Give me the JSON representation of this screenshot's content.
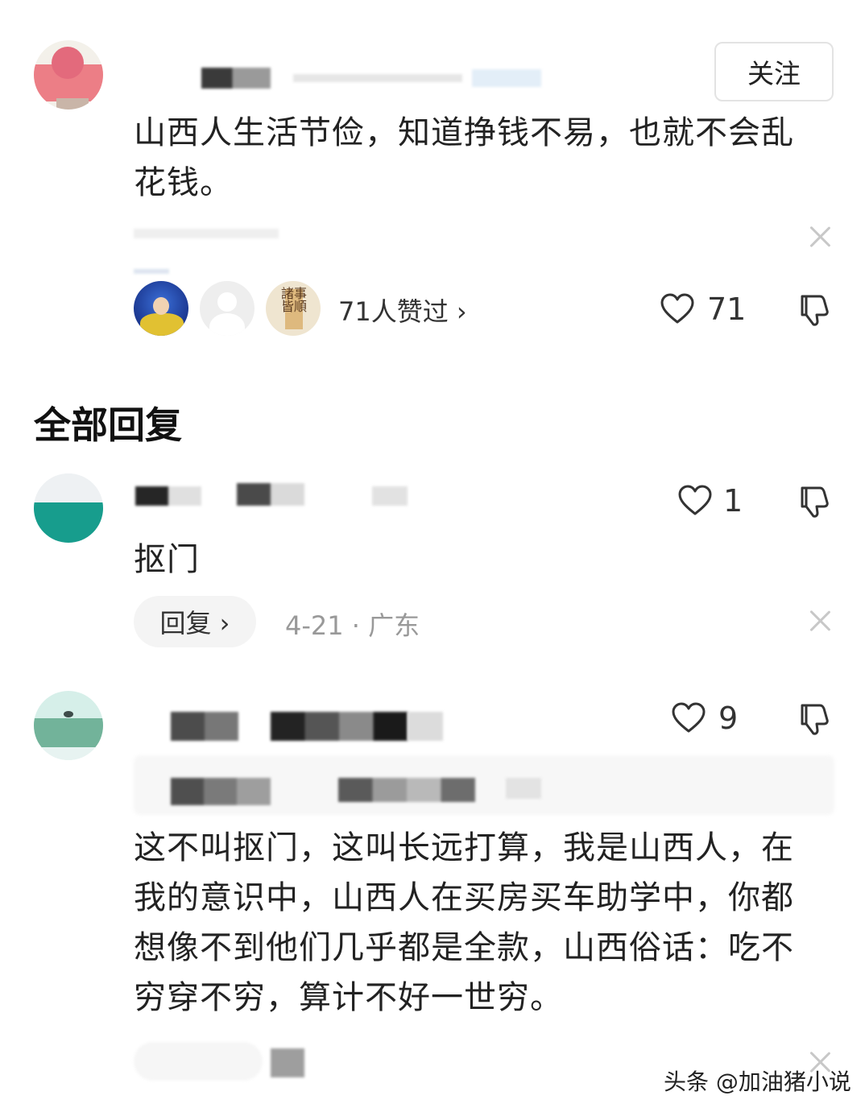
{
  "main_comment": {
    "follow_label": "关注",
    "text_line1": "山西人生活节俭，知道挣钱不易，也就不会乱",
    "text_line2": "花钱。",
    "likes_summary": "71人赞过 ›",
    "like_count": "71"
  },
  "section_title": "全部回复",
  "replies": [
    {
      "like_count": "1",
      "text": "抠门",
      "reply_label": "回复 ›",
      "meta": "4-21 · 广东"
    },
    {
      "like_count": "9",
      "text_lines": [
        "这不叫抠门，这叫长远打算，我是山西人，在",
        "我的意识中，山西人在买房买车助学中，你都",
        "想像不到他们几乎都是全款，山西俗话：吃不",
        "穷穿不穷，算计不好一世穷。"
      ]
    }
  ],
  "liker_3_chars": "諸事皆順",
  "watermark": "头条 @加油猪小说"
}
